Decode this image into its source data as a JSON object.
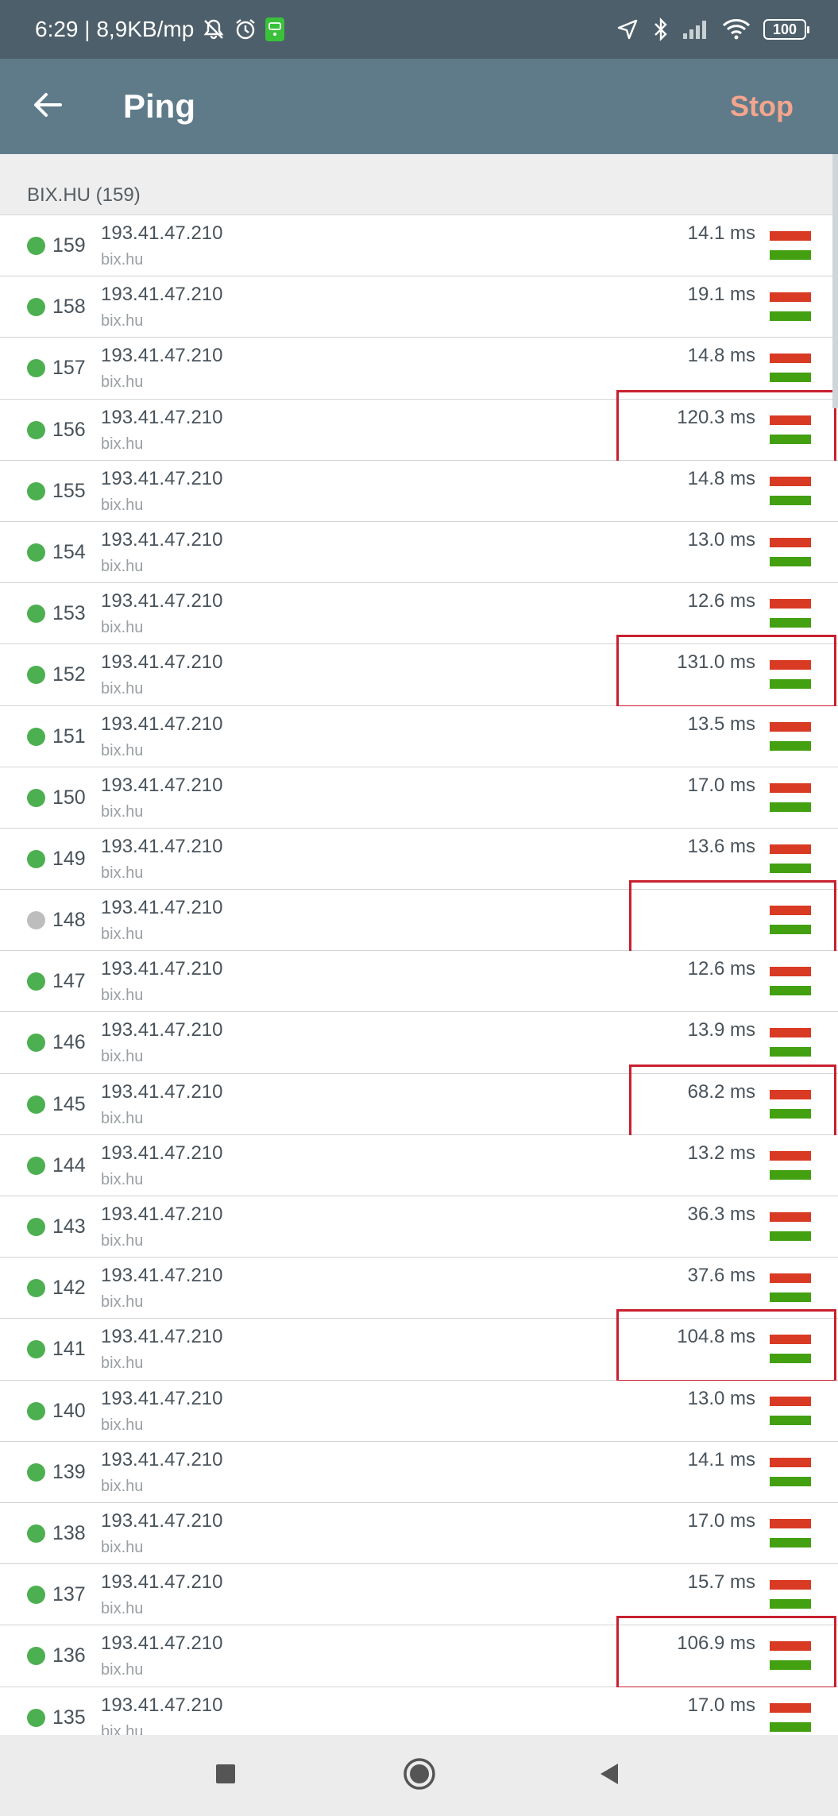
{
  "status_bar": {
    "time_speed": "6:29 | 8,9KB/mp",
    "battery": "100",
    "icons": [
      "mute-icon",
      "alarm-icon",
      "sim-icon",
      "location-arrow-icon",
      "bluetooth-icon",
      "signal-icon",
      "wifi-icon",
      "battery-icon"
    ]
  },
  "app_bar": {
    "title": "Ping",
    "stop_label": "Stop",
    "back_icon": "back-arrow-icon"
  },
  "list": {
    "section_title": "BIX.HU (159)",
    "rows": [
      {
        "seq": "159",
        "ip": "193.41.47.210",
        "host": "bix.hu",
        "ms": "14.1 ms",
        "ok": true
      },
      {
        "seq": "158",
        "ip": "193.41.47.210",
        "host": "bix.hu",
        "ms": "19.1 ms",
        "ok": true
      },
      {
        "seq": "157",
        "ip": "193.41.47.210",
        "host": "bix.hu",
        "ms": "14.8 ms",
        "ok": true
      },
      {
        "seq": "156",
        "ip": "193.41.47.210",
        "host": "bix.hu",
        "ms": "120.3 ms",
        "ok": true,
        "highlight": true
      },
      {
        "seq": "155",
        "ip": "193.41.47.210",
        "host": "bix.hu",
        "ms": "14.8 ms",
        "ok": true
      },
      {
        "seq": "154",
        "ip": "193.41.47.210",
        "host": "bix.hu",
        "ms": "13.0 ms",
        "ok": true
      },
      {
        "seq": "153",
        "ip": "193.41.47.210",
        "host": "bix.hu",
        "ms": "12.6 ms",
        "ok": true
      },
      {
        "seq": "152",
        "ip": "193.41.47.210",
        "host": "bix.hu",
        "ms": "131.0 ms",
        "ok": true,
        "highlight": true
      },
      {
        "seq": "151",
        "ip": "193.41.47.210",
        "host": "bix.hu",
        "ms": "13.5 ms",
        "ok": true
      },
      {
        "seq": "150",
        "ip": "193.41.47.210",
        "host": "bix.hu",
        "ms": "17.0 ms",
        "ok": true
      },
      {
        "seq": "149",
        "ip": "193.41.47.210",
        "host": "bix.hu",
        "ms": "13.6 ms",
        "ok": true
      },
      {
        "seq": "148",
        "ip": "193.41.47.210",
        "host": "bix.hu",
        "ms": "",
        "ok": false,
        "highlight": true
      },
      {
        "seq": "147",
        "ip": "193.41.47.210",
        "host": "bix.hu",
        "ms": "12.6 ms",
        "ok": true
      },
      {
        "seq": "146",
        "ip": "193.41.47.210",
        "host": "bix.hu",
        "ms": "13.9 ms",
        "ok": true
      },
      {
        "seq": "145",
        "ip": "193.41.47.210",
        "host": "bix.hu",
        "ms": "68.2 ms",
        "ok": true,
        "highlight": true
      },
      {
        "seq": "144",
        "ip": "193.41.47.210",
        "host": "bix.hu",
        "ms": "13.2 ms",
        "ok": true
      },
      {
        "seq": "143",
        "ip": "193.41.47.210",
        "host": "bix.hu",
        "ms": "36.3 ms",
        "ok": true
      },
      {
        "seq": "142",
        "ip": "193.41.47.210",
        "host": "bix.hu",
        "ms": "37.6 ms",
        "ok": true
      },
      {
        "seq": "141",
        "ip": "193.41.47.210",
        "host": "bix.hu",
        "ms": "104.8 ms",
        "ok": true,
        "highlight": true
      },
      {
        "seq": "140",
        "ip": "193.41.47.210",
        "host": "bix.hu",
        "ms": "13.0 ms",
        "ok": true
      },
      {
        "seq": "139",
        "ip": "193.41.47.210",
        "host": "bix.hu",
        "ms": "14.1 ms",
        "ok": true
      },
      {
        "seq": "138",
        "ip": "193.41.47.210",
        "host": "bix.hu",
        "ms": "17.0 ms",
        "ok": true
      },
      {
        "seq": "137",
        "ip": "193.41.47.210",
        "host": "bix.hu",
        "ms": "15.7 ms",
        "ok": true
      },
      {
        "seq": "136",
        "ip": "193.41.47.210",
        "host": "bix.hu",
        "ms": "106.9 ms",
        "ok": true,
        "highlight": true
      },
      {
        "seq": "135",
        "ip": "193.41.47.210",
        "host": "bix.hu",
        "ms": "17.0 ms",
        "ok": true
      }
    ]
  },
  "colors": {
    "status_ok": "#4caf50",
    "status_missing": "#bdbdbd",
    "bar_red": "#d93a23",
    "bar_green": "#43a010",
    "highlight": "#c8202f",
    "app_bar": "#5f7b89",
    "status_bar": "#4d5f6a",
    "stop_label": "#f4a58e"
  },
  "nav_bar": {
    "icons": [
      "recents-square-icon",
      "home-circle-icon",
      "back-triangle-icon"
    ]
  }
}
